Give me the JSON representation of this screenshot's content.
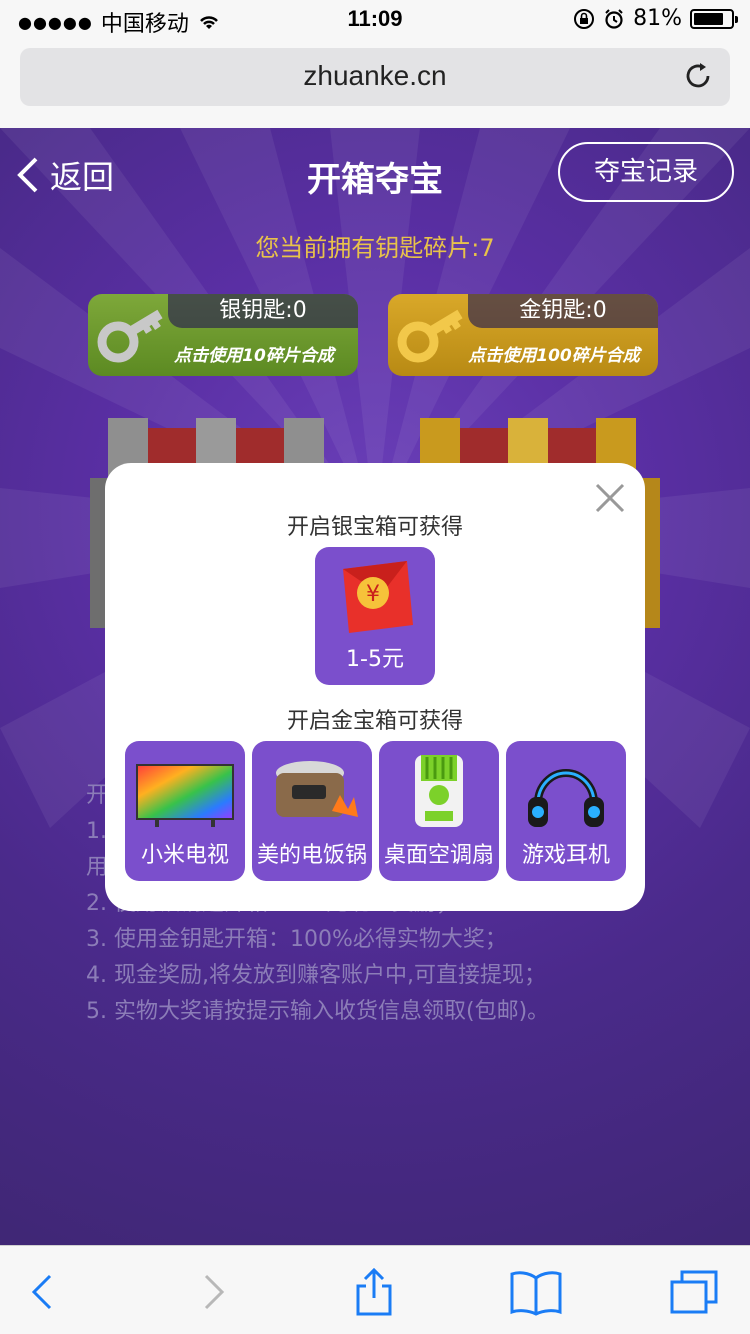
{
  "status_bar": {
    "carrier": "中国移动",
    "time": "11:09",
    "battery": "81%",
    "battery_level": 0.81
  },
  "browser": {
    "url": "zhuanke.cn"
  },
  "header": {
    "back_label": "返回",
    "title": "开箱夺宝",
    "record_button": "夺宝记录"
  },
  "shard_info": "您当前拥有钥匙碎片:7",
  "keys": [
    {
      "name": "银钥匙:0",
      "tip": "点击使用10碎片合成"
    },
    {
      "name": "金钥匙:0",
      "tip": "点击使用100碎片合成"
    }
  ],
  "rules": {
    "title_partial": "开",
    "lines": [
      "1.",
      "用",
      "2. 使用银钥匙开箱：1-5元现金奖励；",
      "3. 使用金钥匙开箱：100%必得实物大奖；",
      "4. 现金奖励,将发放到赚客账户中,可直接提现；",
      "5. 实物大奖请按提示输入收货信息领取(包邮)。"
    ]
  },
  "modal": {
    "silver_title": "开启银宝箱可获得",
    "silver_prize": "1-5元",
    "gold_title": "开启金宝箱可获得",
    "gold_prizes": [
      "小米电视",
      "美的电饭锅",
      "桌面空调扇",
      "游戏耳机"
    ]
  },
  "colors": {
    "page_purple": "#5a2fa4",
    "card_purple": "#7b4fcc",
    "ios_blue": "#1a7cf5",
    "shard_gold": "#e8c24a"
  }
}
